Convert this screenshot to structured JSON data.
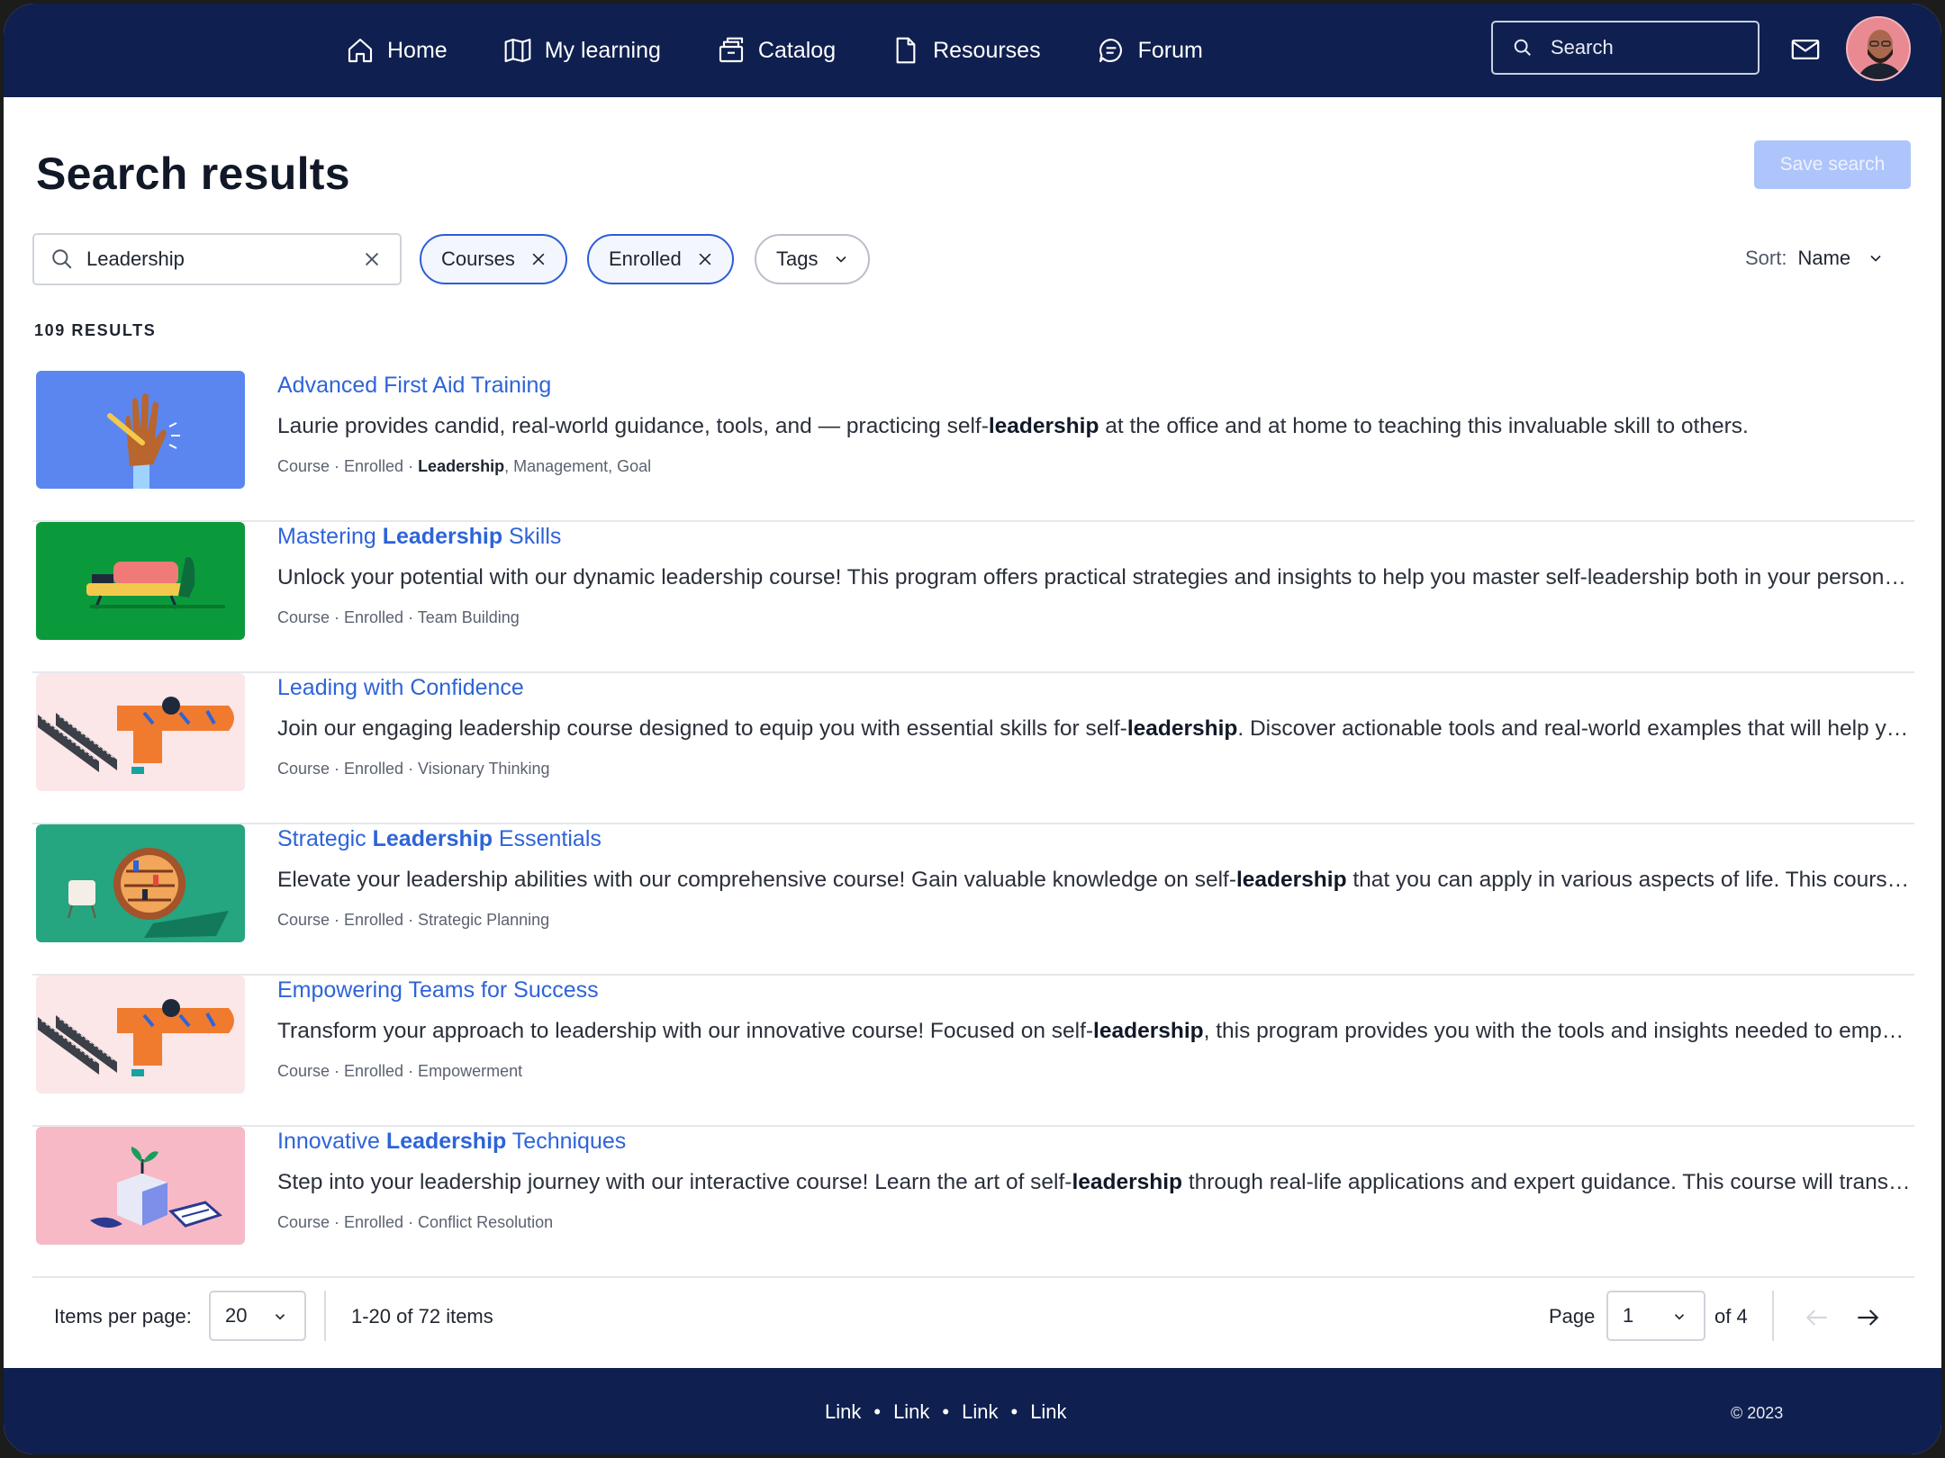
{
  "nav": {
    "items": [
      {
        "label": "Home",
        "icon": "home-icon"
      },
      {
        "label": "My learning",
        "icon": "book-icon"
      },
      {
        "label": "Catalog",
        "icon": "catalog-icon"
      },
      {
        "label": "Resourses",
        "icon": "document-icon"
      },
      {
        "label": "Forum",
        "icon": "chat-icon"
      }
    ],
    "search_placeholder": "Search"
  },
  "header": {
    "title": "Search results",
    "save_label": "Save search"
  },
  "filters": {
    "query": "Leadership",
    "chips": [
      {
        "label": "Courses",
        "state": "active"
      },
      {
        "label": "Enrolled",
        "state": "active"
      },
      {
        "label": "Tags",
        "state": "dropdown"
      }
    ],
    "sort_label": "Sort:",
    "sort_value": "Name"
  },
  "results_count": "109 RESULTS",
  "results": [
    {
      "title_pre": "Advanced First Aid Training",
      "title_bold": "",
      "title_post": "",
      "desc_pre": "Laurie provides candid, real-world guidance, tools, and — practicing self-",
      "desc_bold": "leadership",
      "desc_post": " at the office and at home to teaching this invaluable skill to others.",
      "meta_pre": "Course · Enrolled  · ",
      "meta_bold": "Leadership",
      "meta_post": ", Management, Goal",
      "thumb_color": "#5b86f0"
    },
    {
      "title_pre": "Mastering ",
      "title_bold": "Leadership",
      "title_post": " Skills",
      "desc_pre": "Unlock your potential with our dynamic leadership course! This program offers practical strategies and insights to help you master self-leadership both in your personal and professional life.",
      "desc_bold": "",
      "desc_post": "",
      "meta_pre": "Course · Enrolled  · Team Building",
      "meta_bold": "",
      "meta_post": "",
      "thumb_color": "#0b9a3b"
    },
    {
      "title_pre": "Leading with Confidence",
      "title_bold": "",
      "title_post": "",
      "desc_pre": "Join our engaging leadership course designed to equip you with essential skills for self-",
      "desc_bold": "leadership",
      "desc_post": ". Discover actionable tools and real-world examples that will help you lead with confidence.",
      "meta_pre": "Course · Enrolled  · Visionary Thinking",
      "meta_bold": "",
      "meta_post": "",
      "thumb_color": "#fbe6e8"
    },
    {
      "title_pre": "Strategic ",
      "title_bold": "Leadership",
      "title_post": " Essentials",
      "desc_pre": "Elevate your leadership abilities with our comprehensive course! Gain valuable knowledge on self-",
      "desc_bold": "leadership",
      "desc_post": " that you can apply in various aspects of life. This course covers the essentials.",
      "meta_pre": "Course · Enrolled  · Strategic Planning",
      "meta_bold": "",
      "meta_post": "",
      "thumb_color": "#25a580"
    },
    {
      "title_pre": "Empowering Teams for Success",
      "title_bold": "",
      "title_post": "",
      "desc_pre": "Transform your approach to leadership with our innovative course! Focused on self-",
      "desc_bold": "leadership",
      "desc_post": ", this program provides you with the tools and insights needed to empower your team.",
      "meta_pre": "Course · Enrolled  · Empowerment",
      "meta_bold": "",
      "meta_post": "",
      "thumb_color": "#fbe6e8"
    },
    {
      "title_pre": "Innovative ",
      "title_bold": "Leadership",
      "title_post": " Techniques",
      "desc_pre": "Step into your leadership journey with our interactive course! Learn the art of self-",
      "desc_bold": "leadership",
      "desc_post": " through real-life applications and expert guidance. This course will transform the way you lead.",
      "meta_pre": "Course · Enrolled  · Conflict Resolution",
      "meta_bold": "",
      "meta_post": "",
      "thumb_color": "#f8b9c6"
    }
  ],
  "pagination": {
    "items_per_page_label": "Items per page:",
    "items_per_page": "20",
    "range": "1-20 of 72 items",
    "page_label": "Page",
    "page": "1",
    "of_label": "of 4"
  },
  "footer": {
    "links": [
      "Link",
      "Link",
      "Link",
      "Link"
    ],
    "copyright": "© 2023"
  }
}
